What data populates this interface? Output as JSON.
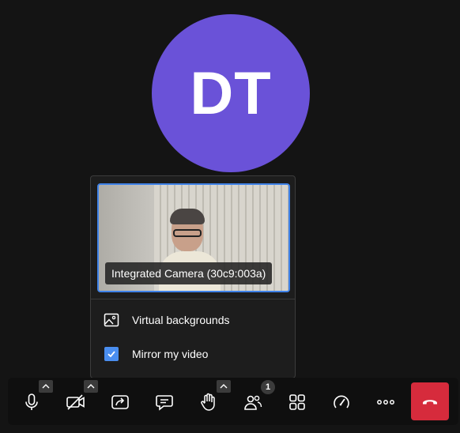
{
  "participant": {
    "initials": "DT",
    "avatar_color": "#6a52d8"
  },
  "video_settings": {
    "camera_label": "Integrated Camera (30c9:003a)",
    "selected_border_color": "#3f82e8",
    "menu": {
      "virtual_backgrounds_label": "Virtual backgrounds",
      "mirror_label": "Mirror my video",
      "mirror_checked": true
    }
  },
  "toolbar": {
    "buttons": [
      {
        "name": "microphone",
        "icon": "microphone-icon",
        "has_caret": true
      },
      {
        "name": "camera",
        "icon": "camera-off-icon",
        "has_caret": true
      },
      {
        "name": "share-screen",
        "icon": "share-screen-icon",
        "has_caret": false
      },
      {
        "name": "chat",
        "icon": "chat-icon",
        "has_caret": false
      },
      {
        "name": "raise-hand",
        "icon": "hand-icon",
        "has_caret": true
      },
      {
        "name": "participants",
        "icon": "participants-icon",
        "badge": "1"
      },
      {
        "name": "tile-view",
        "icon": "grid-icon",
        "has_caret": false
      },
      {
        "name": "performance",
        "icon": "speedometer-icon",
        "has_caret": false
      },
      {
        "name": "more",
        "icon": "more-icon",
        "has_caret": false
      },
      {
        "name": "hangup",
        "icon": "phone-hangup-icon",
        "color": "#d62b3c"
      }
    ],
    "participants_badge": "1"
  }
}
